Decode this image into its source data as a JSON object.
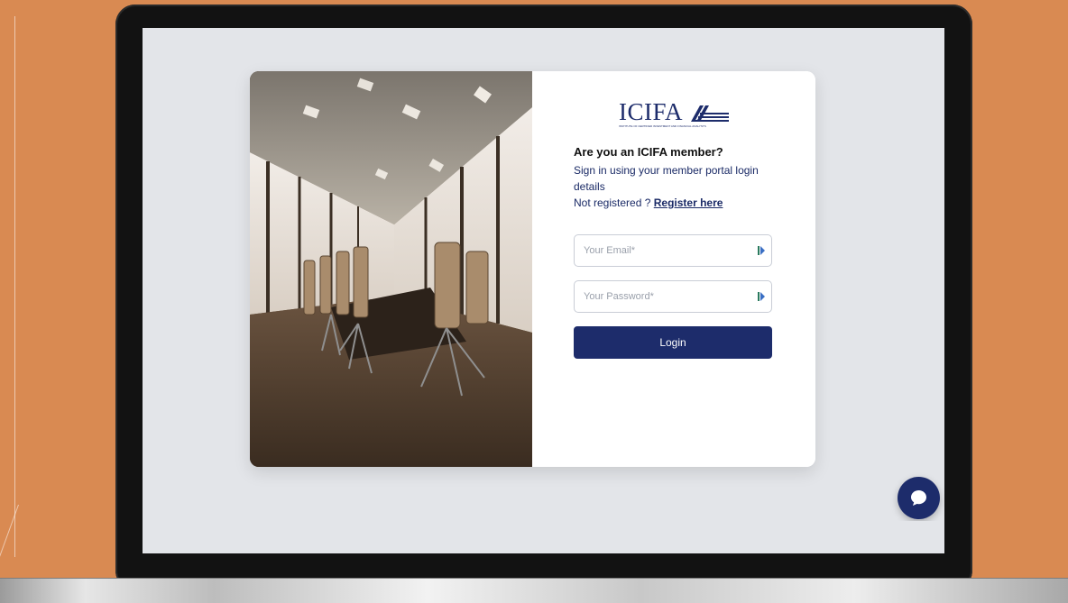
{
  "logo": {
    "text": "ICIFA",
    "subtext": "INSTITUTE OF CERTIFIED INVESTMENT AND FINANCIAL ANALYSTS"
  },
  "login": {
    "heading": "Are you an ICIFA member?",
    "subtext": "Sign in using your member portal login details",
    "not_registered": "Not registered ?",
    "register_link": "Register here",
    "email_placeholder": "Your Email*",
    "password_placeholder": "Your Password*",
    "login_button": "Login"
  },
  "icons": {
    "email_field_icon": "password-manager-key-icon",
    "password_field_icon": "password-manager-key-icon",
    "chat_button_icon": "chat-bubble-icon"
  },
  "colors": {
    "background": "#d98a52",
    "screen": "#e3e5e9",
    "brand": "#1d2c6b",
    "text_dark": "#111111",
    "input_border": "#c9cdd6"
  }
}
